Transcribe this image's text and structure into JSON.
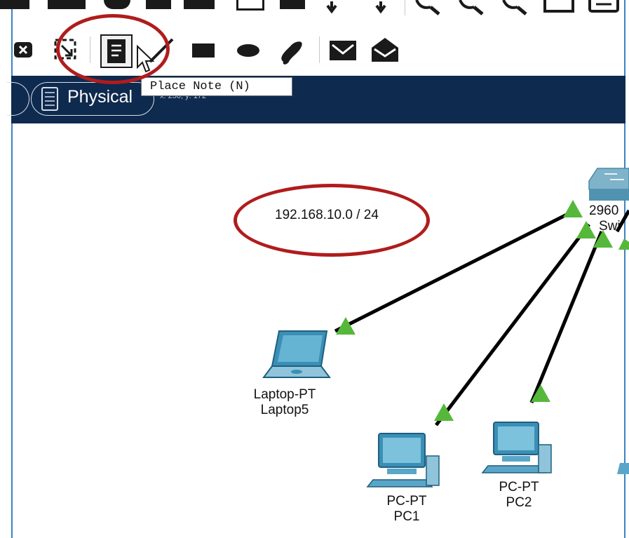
{
  "toolbar": {
    "top_icons": [
      "select-icon",
      "print-icon",
      "info-icon",
      "user-icon",
      "inspect-icon",
      "note-icon",
      "page-icon",
      "arrow-down-icon",
      "arrow-down-icon",
      "zoom-in-icon",
      "zoom-out-icon",
      "zoom-reset-icon",
      "rectangle-icon",
      "palette-icon"
    ],
    "drawing_icons": [
      "delete-icon",
      "resize-icon",
      "place-note-icon",
      "line-icon",
      "rectangle-icon",
      "ellipse-icon",
      "freeform-icon",
      "pdu-icon",
      "complex-pdu-icon"
    ],
    "tooltip": "Place Note (N)"
  },
  "workspace_bar": {
    "mode_label": "Physical",
    "coordinates": "x: 250, y: 172"
  },
  "canvas": {
    "note_text": "192.168.10.0 / 24",
    "switch": {
      "line1": "2960",
      "line2": "Swi"
    },
    "devices": [
      {
        "type": "Laptop-PT",
        "name": "Laptop5"
      },
      {
        "type": "PC-PT",
        "name": "PC1"
      },
      {
        "type": "PC-PT",
        "name": "PC2"
      }
    ]
  },
  "colors": {
    "workspace_bar": "#0f2a4f",
    "link": "#000000",
    "link_status": "#56b83b",
    "annotation": "#b01c1c",
    "device": "#2f8fb5"
  }
}
